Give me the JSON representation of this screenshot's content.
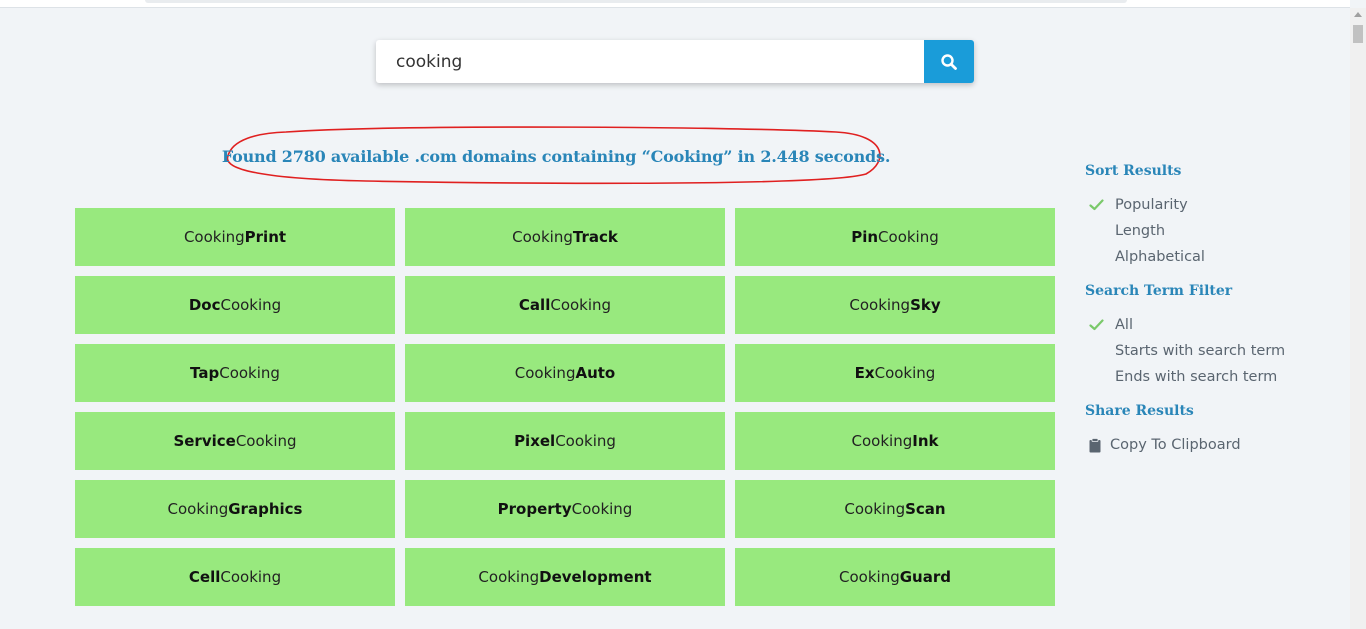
{
  "search": {
    "value": "cooking",
    "button_icon": "search-icon",
    "accent": "#1a9cd9"
  },
  "summary": {
    "text": "Found 2780 available .com domains containing “Cooking” in 2.448 seconds.",
    "annotation_color": "#e02020"
  },
  "results": [
    {
      "pre": "Cooking",
      "bold": "Print",
      "post": ""
    },
    {
      "pre": "Cooking",
      "bold": "Track",
      "post": ""
    },
    {
      "pre": "",
      "bold": "Pin",
      "post": "Cooking"
    },
    {
      "pre": "",
      "bold": "Doc",
      "post": "Cooking"
    },
    {
      "pre": "",
      "bold": "Call",
      "post": "Cooking"
    },
    {
      "pre": "Cooking",
      "bold": "Sky",
      "post": ""
    },
    {
      "pre": "",
      "bold": "Tap",
      "post": "Cooking"
    },
    {
      "pre": "Cooking",
      "bold": "Auto",
      "post": ""
    },
    {
      "pre": "",
      "bold": "Ex",
      "post": "Cooking"
    },
    {
      "pre": "",
      "bold": "Service",
      "post": "Cooking"
    },
    {
      "pre": "",
      "bold": "Pixel",
      "post": "Cooking"
    },
    {
      "pre": "Cooking",
      "bold": "Ink",
      "post": ""
    },
    {
      "pre": "Cooking",
      "bold": "Graphics",
      "post": ""
    },
    {
      "pre": "",
      "bold": "Property",
      "post": "Cooking"
    },
    {
      "pre": "Cooking",
      "bold": "Scan",
      "post": ""
    },
    {
      "pre": "",
      "bold": "Cell",
      "post": "Cooking"
    },
    {
      "pre": "Cooking",
      "bold": "Development",
      "post": ""
    },
    {
      "pre": "Cooking",
      "bold": "Guard",
      "post": ""
    }
  ],
  "colors": {
    "result_bg": "#98e97e",
    "heading": "#2a86b8",
    "check": "#7ac96a"
  },
  "sidebar": {
    "sort": {
      "title": "Sort Results",
      "options": [
        {
          "label": "Popularity",
          "selected": true
        },
        {
          "label": "Length",
          "selected": false
        },
        {
          "label": "Alphabetical",
          "selected": false
        }
      ]
    },
    "filter": {
      "title": "Search Term Filter",
      "options": [
        {
          "label": "All",
          "selected": true
        },
        {
          "label": "Starts with search term",
          "selected": false
        },
        {
          "label": "Ends with search term",
          "selected": false
        }
      ]
    },
    "share": {
      "title": "Share Results",
      "copy_label": "Copy To Clipboard",
      "copy_icon": "clipboard-icon"
    }
  }
}
